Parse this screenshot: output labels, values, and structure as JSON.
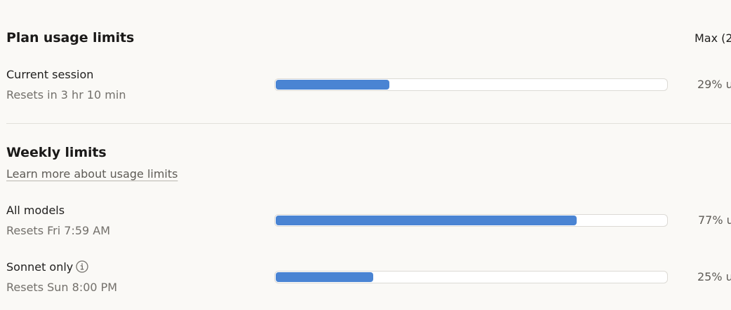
{
  "plan": {
    "title": "Plan usage limits",
    "plan_label": "Max (2"
  },
  "current_session": {
    "label": "Current session",
    "reset": "Resets in 3 hr 10 min",
    "percent": 29,
    "percent_text": "29% u"
  },
  "weekly": {
    "title": "Weekly limits",
    "learn_link": "Learn more about usage limits",
    "all_models": {
      "label": "All models",
      "reset": "Resets Fri 7:59 AM",
      "percent": 77,
      "percent_text": "77% u"
    },
    "sonnet": {
      "label": "Sonnet only",
      "info_icon": "info-icon",
      "reset": "Resets Sun 8:00 PM",
      "percent": 25,
      "percent_text": "25% u"
    }
  },
  "colors": {
    "accent": "#4a84d3",
    "background": "#faf9f6"
  }
}
